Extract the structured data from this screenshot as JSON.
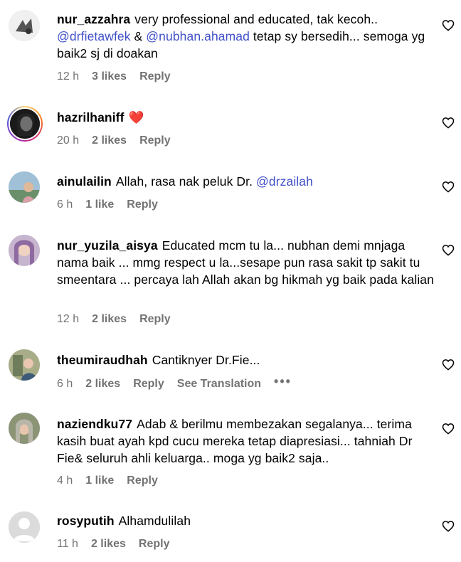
{
  "comments": [
    {
      "username": "nur_azzahra",
      "segments": [
        {
          "text": "very professional and educated, tak kecoh.. ",
          "mention": false
        },
        {
          "text": "@drfietawfek",
          "mention": true
        },
        {
          "text": " & ",
          "mention": false
        },
        {
          "text": "@nubhan.ahamad",
          "mention": true
        },
        {
          "text": " tetap sy bersedih... semoga yg baik2 sj di doakan",
          "mention": false
        }
      ],
      "time": "12 h",
      "likes": "3 likes",
      "reply": "Reply",
      "avatar_color": "#cccccc"
    },
    {
      "username": "hazrilhaniff",
      "segments": [
        {
          "text": "❤️",
          "mention": false
        }
      ],
      "time": "20 h",
      "likes": "2 likes",
      "reply": "Reply",
      "avatar_color": "#222222"
    },
    {
      "username": "ainulailin",
      "segments": [
        {
          "text": "Allah, rasa nak peluk Dr. ",
          "mention": false
        },
        {
          "text": "@drzailah",
          "mention": true
        }
      ],
      "time": "6 h",
      "likes": "1 like",
      "reply": "Reply",
      "avatar_color": "#8fb3c9"
    },
    {
      "username": "nur_yuzila_aisya",
      "segments": [
        {
          "text": "Educated mcm tu la... nubhan demi mnjaga nama baik ... mmg respect u la...sesape pun rasa sakit tp sakit tu smeentara ... percaya lah Allah akan bg hikmah yg baik pada kalian",
          "mention": false
        }
      ],
      "time": "12 h",
      "likes": "2 likes",
      "reply": "Reply",
      "avatar_color": "#b39ab8"
    },
    {
      "username": "theumiraudhah",
      "segments": [
        {
          "text": "Cantiknyer Dr.Fie...",
          "mention": false
        }
      ],
      "time": "6 h",
      "likes": "2 likes",
      "reply": "Reply",
      "translate": "See Translation",
      "more": "•••",
      "avatar_color": "#9aa07a"
    },
    {
      "username": "naziendku77",
      "segments": [
        {
          "text": "Adab & berilmu membezakan segalanya... terima kasih buat ayah kpd cucu mereka tetap diapresiasi... tahniah Dr Fie& seluruh ahli keluarga.. moga yg baik2 saja..",
          "mention": false
        }
      ],
      "time": "4 h",
      "likes": "1 like",
      "reply": "Reply",
      "avatar_color": "#7f8a6a"
    },
    {
      "username": "rosyputih",
      "segments": [
        {
          "text": "Alhamdulilah",
          "mention": false
        }
      ],
      "time": "11 h",
      "likes": "2 likes",
      "reply": "Reply",
      "avatar_color": "#dbdbdb"
    }
  ],
  "icons": {
    "like": "heart-outline-icon",
    "default_avatar": "person-silhouette-icon"
  },
  "colors": {
    "mention": "#4150c8",
    "meta": "#737373"
  }
}
